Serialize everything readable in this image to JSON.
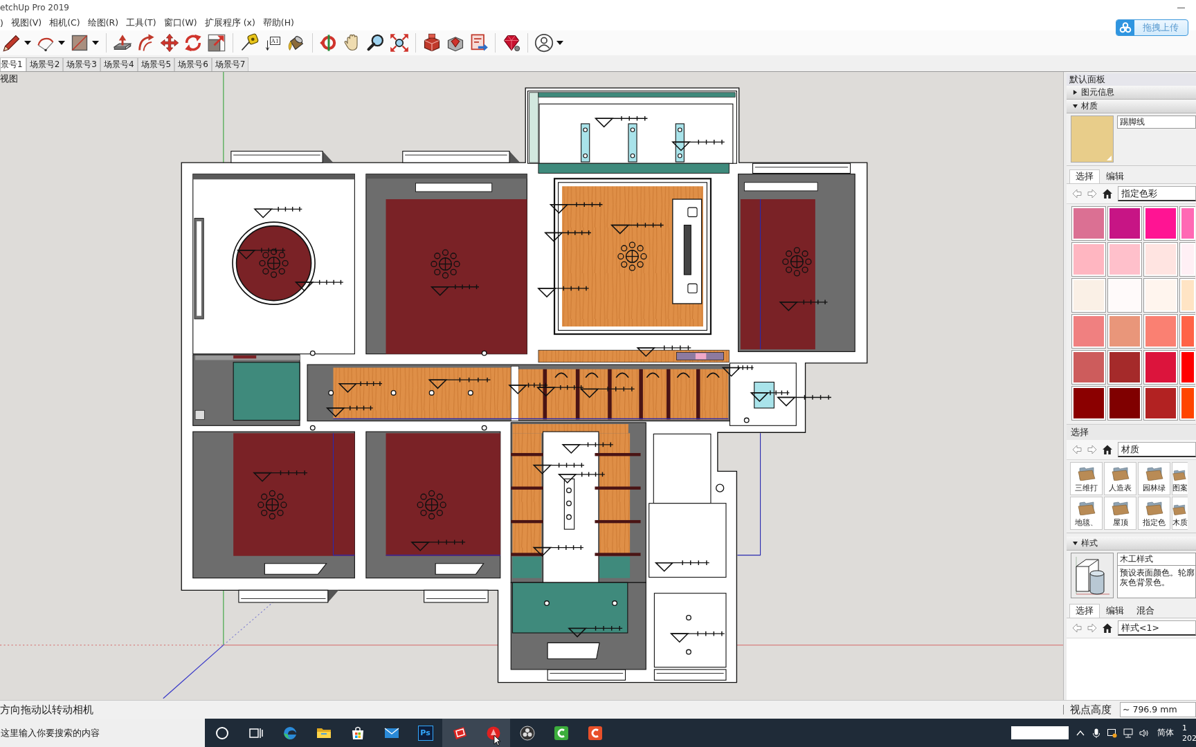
{
  "window": {
    "title": "etchUp Pro 2019"
  },
  "upload_button": {
    "label": "拖拽上传"
  },
  "menu": [
    ")",
    "视图(V)",
    "相机(C)",
    "绘图(R)",
    "工具(T)",
    "窗口(W)",
    "扩展程序 (x)",
    "帮助(H)"
  ],
  "toolbar": [
    {
      "tools": [
        {
          "kind": "pencil",
          "dropdown": true
        },
        {
          "kind": "arc",
          "dropdown": true
        },
        {
          "kind": "rectangle",
          "dropdown": true
        }
      ]
    },
    {
      "tools": [
        {
          "kind": "push_pull",
          "dropdown": false
        },
        {
          "kind": "offset",
          "dropdown": false
        },
        {
          "kind": "move",
          "dropdown": false
        },
        {
          "kind": "rotate",
          "dropdown": false
        },
        {
          "kind": "scale",
          "dropdown": false
        }
      ]
    },
    {
      "tools": [
        {
          "kind": "tape",
          "dropdown": false
        },
        {
          "kind": "text",
          "label": "A1",
          "dropdown": false
        },
        {
          "kind": "paint",
          "dropdown": false
        }
      ]
    },
    {
      "tools": [
        {
          "kind": "orbit",
          "dropdown": false
        },
        {
          "kind": "pan",
          "dropdown": false
        },
        {
          "kind": "zoom",
          "dropdown": false
        },
        {
          "kind": "zoom_extents",
          "dropdown": false
        }
      ]
    },
    {
      "tools": [
        {
          "kind": "warehouse",
          "dropdown": false
        },
        {
          "kind": "extensions",
          "dropdown": false
        },
        {
          "kind": "share",
          "dropdown": false
        }
      ]
    },
    {
      "tools": [
        {
          "kind": "ruby",
          "dropdown": false
        }
      ]
    },
    {
      "tools": [
        {
          "kind": "account",
          "dropdown": true
        }
      ]
    }
  ],
  "scene_tabs": [
    {
      "label": "景号1",
      "selected": true
    },
    {
      "label": "场景号2",
      "selected": false
    },
    {
      "label": "场景号3",
      "selected": false
    },
    {
      "label": "场景号4",
      "selected": false
    },
    {
      "label": "场景号5",
      "selected": false
    },
    {
      "label": "场景号6",
      "selected": false
    },
    {
      "label": "场景号7",
      "selected": false
    }
  ],
  "viewport": {
    "label": "视图"
  },
  "panel": {
    "title": "默认面板",
    "entity_info": {
      "title": "图元信息",
      "expanded": false
    },
    "materials": {
      "title": "材质",
      "expanded": true,
      "color": "#e8cd8a",
      "name": "踢脚线",
      "tabs": [
        {
          "label": "选择",
          "selected": true
        },
        {
          "label": "编辑",
          "selected": false
        }
      ],
      "library": "指定色彩",
      "swatches": [
        {
          "color": "#db7093"
        },
        {
          "color": "#c71585"
        },
        {
          "color": "#ff1493"
        },
        {
          "color": "#ff69b4"
        },
        {
          "color": "#ffb6c1"
        },
        {
          "color": "#ffc0cb"
        },
        {
          "color": "#ffe4e1"
        },
        {
          "color": "#fff0f5"
        },
        {
          "color": "#faf0e6"
        },
        {
          "color": "#fffafa"
        },
        {
          "color": "#fff5ee"
        },
        {
          "color": "#ffe4c4"
        },
        {
          "color": "#f08080"
        },
        {
          "color": "#e9967a"
        },
        {
          "color": "#fa8072"
        },
        {
          "color": "#ff6347"
        },
        {
          "color": "#cd5c5c"
        },
        {
          "color": "#a52a2a"
        },
        {
          "color": "#dc143c"
        },
        {
          "color": "#ff0000"
        },
        {
          "color": "#8b0000"
        },
        {
          "color": "#800000"
        },
        {
          "color": "#b22222"
        },
        {
          "color": "#ff4500"
        }
      ],
      "browser_label": "选择",
      "browser_library": "材质",
      "folders": [
        {
          "label": "三维打"
        },
        {
          "label": "人造表"
        },
        {
          "label": "园林绿"
        },
        {
          "label": "图案"
        },
        {
          "label": "地毯、"
        },
        {
          "label": "屋顶"
        },
        {
          "label": "指定色"
        },
        {
          "label": "木质"
        }
      ]
    },
    "styles": {
      "title": "样式",
      "expanded": true,
      "name": "木工样式",
      "description": "预设表面颜色。轮廓灰色背景色。",
      "tabs": [
        {
          "label": "选择",
          "selected": true
        },
        {
          "label": "编辑",
          "selected": false
        },
        {
          "label": "混合",
          "selected": false
        }
      ],
      "library": "样式<1>"
    }
  },
  "status_bar": {
    "hint": "方向拖动以转动相机",
    "measurement_label": "视点高度",
    "measurement_value": "~ 796.9 mm"
  },
  "taskbar": {
    "search_placeholder": "这里输入你要搜索的内容",
    "apps": [
      {
        "kind": "cortana",
        "active": false,
        "hovered": false
      },
      {
        "kind": "task_view",
        "active": false,
        "hovered": false
      },
      {
        "kind": "edge",
        "active": false,
        "hovered": false
      },
      {
        "kind": "explorer",
        "active": false,
        "hovered": false
      },
      {
        "kind": "store",
        "active": false,
        "hovered": false
      },
      {
        "kind": "mail",
        "active": false,
        "hovered": false
      },
      {
        "kind": "photoshop",
        "label": "Ps",
        "active": false,
        "hovered": false
      },
      {
        "kind": "sketchup",
        "active": true,
        "hovered": false
      },
      {
        "kind": "red_app",
        "active": true,
        "hovered": true
      },
      {
        "kind": "obs",
        "active": false,
        "hovered": false
      },
      {
        "kind": "camtasia",
        "active": false,
        "hovered": false
      },
      {
        "kind": "recorder",
        "active": false,
        "hovered": false
      }
    ],
    "ime": "简体",
    "clock": {
      "time": "1",
      "date": "202"
    }
  }
}
